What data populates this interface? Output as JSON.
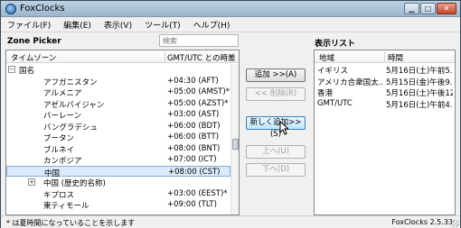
{
  "window": {
    "title": "FoxClocks"
  },
  "menu": [
    "ファイル(F)",
    "編集(E)",
    "表示(V)",
    "ツール(T)",
    "ヘルプ(H)"
  ],
  "zone_picker": {
    "title": "Zone Picker",
    "search_placeholder": "検索",
    "columns": {
      "zone": "タイムゾーン",
      "offset": "GMT/UTC との時差"
    },
    "rows": [
      {
        "label": "国名",
        "offset": "",
        "expander": "−",
        "level": 1
      },
      {
        "label": "アフガニスタン",
        "offset": "+04:30 (AFT)",
        "level": 2
      },
      {
        "label": "アルメニア",
        "offset": "+05:00 (AMST)*",
        "level": 2
      },
      {
        "label": "アゼルバイジャン",
        "offset": "+05:00 (AZST)*",
        "level": 2
      },
      {
        "label": "バーレーン",
        "offset": "+03:00 (AST)",
        "level": 2
      },
      {
        "label": "バングラデシュ",
        "offset": "+06:00 (BDT)",
        "level": 2
      },
      {
        "label": "ブータン",
        "offset": "+06:00 (BTT)",
        "level": 2
      },
      {
        "label": "ブルネイ",
        "offset": "+08:00 (BNT)",
        "level": 2
      },
      {
        "label": "カンボジア",
        "offset": "+07:00 (ICT)",
        "level": 2
      },
      {
        "label": "中国",
        "offset": "+08:00 (CST)",
        "level": 2,
        "selected": true
      },
      {
        "label": "中国 (歴史的名称)",
        "offset": "",
        "expander": "+",
        "level": 2
      },
      {
        "label": "キプロス",
        "offset": "+03:00 (EEST)*",
        "level": 2
      },
      {
        "label": "東ティモール",
        "offset": "+09:00 (TLT)",
        "level": 2
      }
    ]
  },
  "buttons": {
    "add": "追加 >>(A)",
    "remove": "<< 削除(R)",
    "add_new": "新しく追加>>(S)",
    "up": "上へ(U)",
    "down": "下へ(D)"
  },
  "display_list": {
    "title": "表示リスト",
    "columns": {
      "region": "地域",
      "time": "時間"
    },
    "rows": [
      {
        "region": "イギリス",
        "time": "5月16日(土)午前5..."
      },
      {
        "region": "アメリカ合衆国太...",
        "time": "5月15日(金)午後9..."
      },
      {
        "region": "香港",
        "time": "5月16日(土)午後12..."
      },
      {
        "region": "GMT/UTC",
        "time": "5月16日(土)午前4..."
      }
    ]
  },
  "status": {
    "note": "* は夏時間になっていることを示します",
    "version": "FoxClocks 2.5.33"
  }
}
